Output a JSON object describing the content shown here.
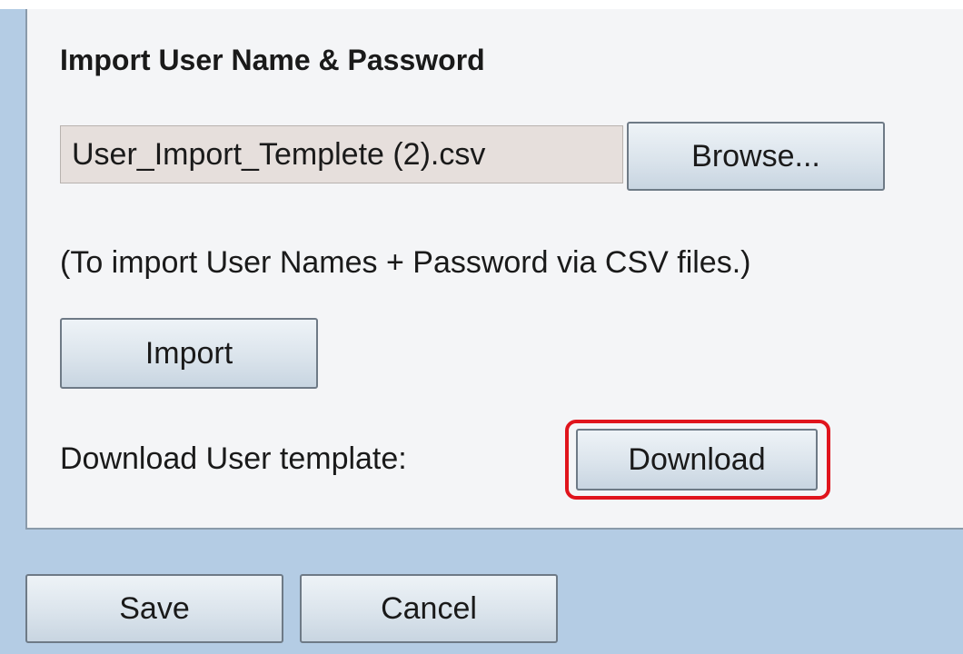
{
  "section": {
    "title": "Import User Name & Password"
  },
  "file_input": {
    "value": "User_Import_Templete (2).csv",
    "browse_label": "Browse..."
  },
  "help_text": "(To import User Names + Password via CSV files.)",
  "import_label": "Import",
  "download": {
    "label": "Download User template:",
    "button_label": "Download",
    "highlight_color": "#e0141c"
  },
  "footer": {
    "save_label": "Save",
    "cancel_label": "Cancel"
  },
  "colors": {
    "page_background": "#b4cce4",
    "panel_background": "#f4f5f7",
    "file_field_background": "#e6dfdc"
  }
}
